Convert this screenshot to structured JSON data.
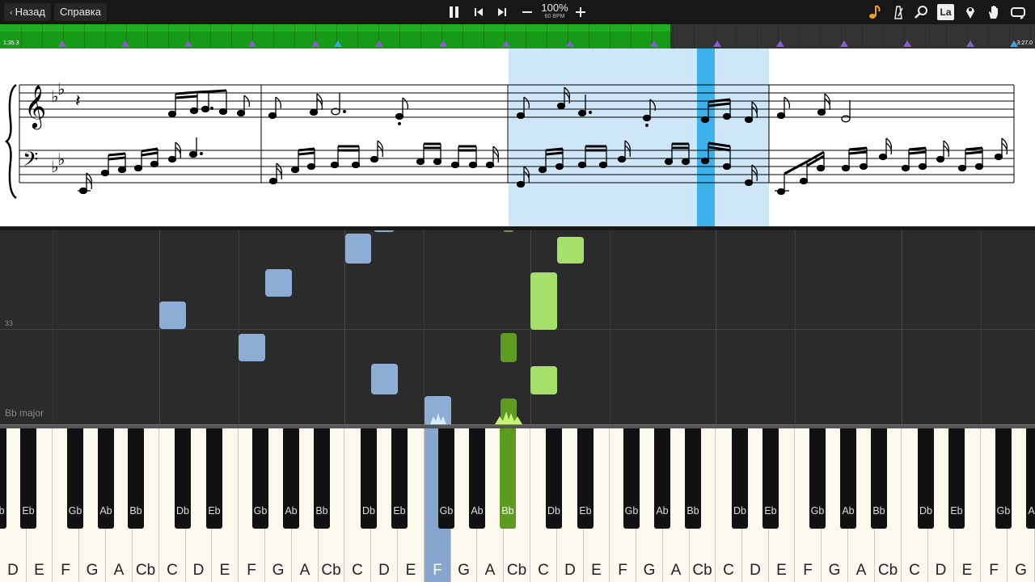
{
  "toolbar": {
    "back_label": "Назад",
    "help_label": "Справка",
    "speed_percent": "100%",
    "speed_bpm": "60 BPM",
    "icons": [
      "pause-icon",
      "skip-back-icon",
      "skip-forward-icon",
      "minus-icon",
      "plus-icon",
      "note-color-icon",
      "metronome-icon",
      "zoom-icon",
      "note-labels-icon",
      "marker-icon",
      "hand-icon",
      "loop-icon"
    ],
    "note_labels_text": "La"
  },
  "timeline": {
    "current_time": "1:35.3",
    "end_time": "3:27.0",
    "progress": 0.648,
    "played_color": "#179a17"
  },
  "roll": {
    "measure_number": "33",
    "key_signature": "Bb major"
  },
  "keyboard": {
    "white_keys": [
      "D",
      "E",
      "F",
      "G",
      "A",
      "Cb",
      "C",
      "D",
      "E",
      "F",
      "G",
      "A",
      "Cb",
      "C",
      "D",
      "E",
      "F",
      "G",
      "A",
      "Cb",
      "C",
      "D",
      "E",
      "F",
      "G",
      "A",
      "Cb",
      "C",
      "D",
      "E",
      "F",
      "G",
      "A",
      "Cb",
      "C",
      "D",
      "E",
      "F",
      "G"
    ],
    "black_keys": [
      "Bb",
      "Eb",
      "Gb",
      "Ab",
      "Bb",
      "Db",
      "Eb",
      "Gb",
      "Ab",
      "Bb",
      "Db",
      "Eb",
      "Gb",
      "Ab",
      "Bb",
      "Db",
      "Eb",
      "Gb",
      "Ab",
      "Bb",
      "Db",
      "Eb",
      "Gb",
      "Ab",
      "Bb",
      "Db",
      "Eb",
      "Gb",
      "Ab"
    ],
    "pressed_white": "F",
    "pressed_black": "Bb",
    "left_hand_color": "#86a6cf",
    "right_hand_color": "#5d9a20"
  }
}
